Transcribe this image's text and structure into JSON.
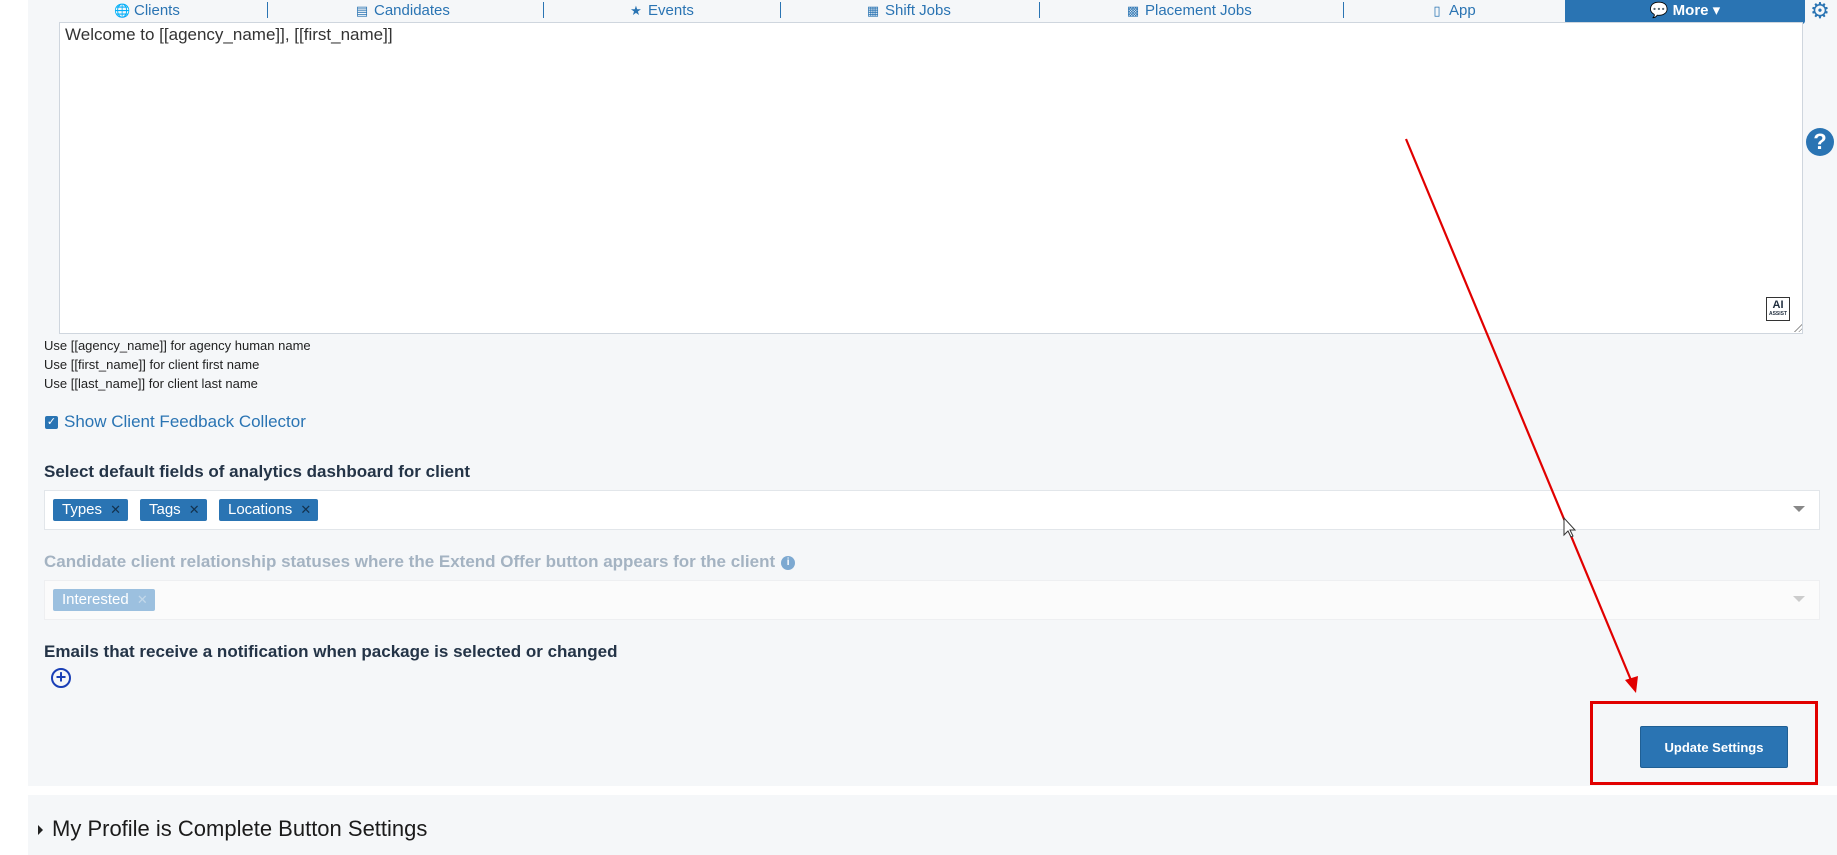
{
  "nav": {
    "items": [
      {
        "label": "Clients",
        "icon": "globe-icon"
      },
      {
        "label": "Candidates",
        "icon": "id-badge-icon"
      },
      {
        "label": "Events",
        "icon": "trophy-icon"
      },
      {
        "label": "Shift Jobs",
        "icon": "calendar-icon"
      },
      {
        "label": "Placement Jobs",
        "icon": "briefcase-icon"
      },
      {
        "label": "App",
        "icon": "mobile-icon"
      }
    ],
    "more_label": "More",
    "active_item": "Events"
  },
  "editor": {
    "content": "Welcome to [[agency_name]], [[first_name]]",
    "ai_badge": "AI",
    "ai_badge_sub": "ASSIST"
  },
  "hints": [
    "Use [[agency_name]] for agency human name",
    "Use [[first_name]] for client first name",
    "Use [[last_name]] for client last name"
  ],
  "feedback_collector": {
    "label": "Show Client Feedback Collector",
    "checked": true
  },
  "analytics_fields": {
    "label": "Select default fields of analytics dashboard for client",
    "tags": [
      "Types",
      "Tags",
      "Locations"
    ]
  },
  "extend_offer": {
    "label": "Candidate client relationship statuses where the Extend Offer button appears for the client",
    "tags": [
      "Interested"
    ],
    "disabled": true
  },
  "notification_emails": {
    "label": "Emails that receive a notification when package is selected or changed"
  },
  "update_button": "Update Settings",
  "next_section": "My Profile is Complete Button Settings",
  "colors": {
    "accent": "#2a74b3",
    "annotation": "#e10000"
  }
}
